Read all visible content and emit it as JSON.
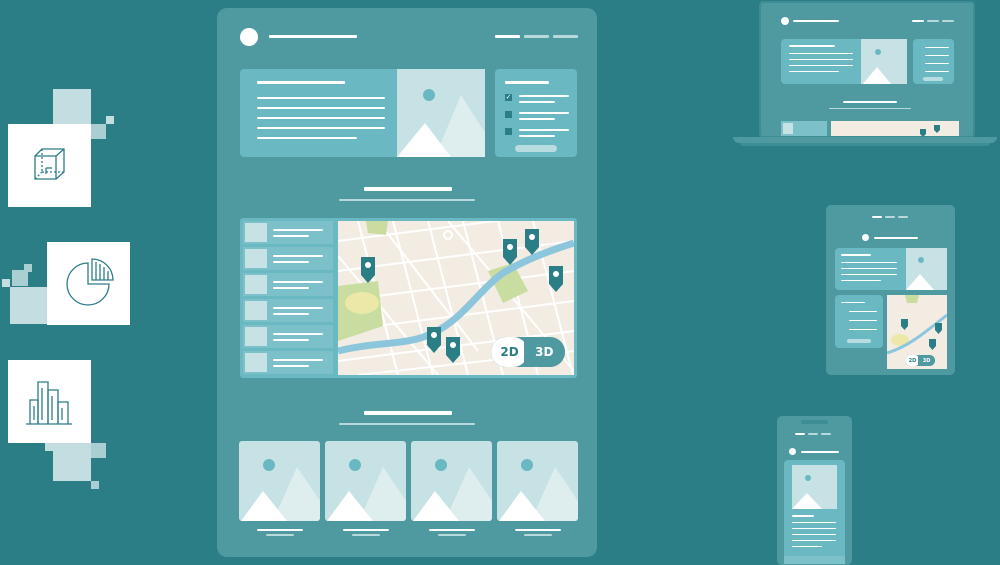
{
  "map": {
    "toggle_2d": "2D",
    "toggle_3d": "3D",
    "mini_toggle_2d": "2D",
    "mini_toggle_3d": "3D"
  },
  "icons": {
    "tile1": "cube-icon",
    "tile2": "pie-chart-icon",
    "tile3": "city-buildings-icon"
  },
  "colors": {
    "background": "#2b7d86",
    "panel": "#4f9aa0",
    "card": "#69b8c2",
    "accent_dark": "#2b7d86",
    "map_bg": "#f2ece2",
    "river": "#8cc6dd",
    "park": "#cfe0a8"
  }
}
